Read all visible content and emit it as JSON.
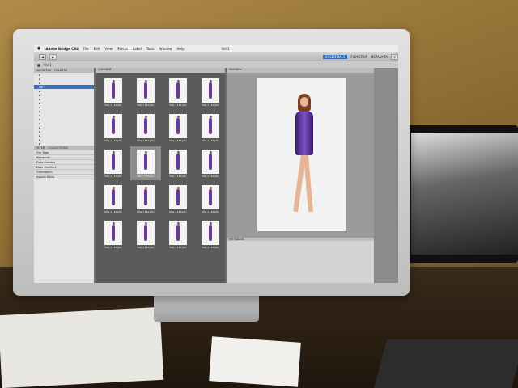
{
  "app": {
    "name": "Adobe Bridge CS4",
    "menu": [
      "File",
      "Edit",
      "View",
      "Stacks",
      "Label",
      "Tools",
      "Window",
      "Help"
    ],
    "window_title": "Vol 1"
  },
  "toolbar": {
    "workspace": "ESSENTIALS",
    "filmstrip": "FILMSTRIP",
    "metadata": "METADATA"
  },
  "left_panel": {
    "tabs": [
      "FAVORITES",
      "FOLDERS"
    ],
    "filter_tabs": [
      "FILTER",
      "COLLECTIONS"
    ],
    "filters": [
      "File Type",
      "Keywords",
      "Date Created",
      "Date Modified",
      "Orientation",
      "Aspect Ratio"
    ]
  },
  "content": {
    "header": "CONTENT"
  },
  "thumbnails": [
    {
      "caption": "IMG_1149.JPG",
      "selected": false
    },
    {
      "caption": "IMG_1150.JPG",
      "selected": false
    },
    {
      "caption": "IMG_1151.JPG",
      "selected": false
    },
    {
      "caption": "IMG_1152.JPG",
      "selected": false
    },
    {
      "caption": "IMG_1153.JPG",
      "selected": false
    },
    {
      "caption": "IMG_1154.JPG",
      "selected": false
    },
    {
      "caption": "IMG_1155.JPG",
      "selected": false
    },
    {
      "caption": "IMG_1156.JPG",
      "selected": false
    },
    {
      "caption": "IMG_1157.JPG",
      "selected": false
    },
    {
      "caption": "IMG_1158.JPG",
      "selected": true
    },
    {
      "caption": "IMG_1159.JPG",
      "selected": false
    },
    {
      "caption": "IMG_1160.JPG",
      "selected": false
    },
    {
      "caption": "IMG_1161.JPG",
      "selected": false
    },
    {
      "caption": "IMG_1162.JPG",
      "selected": false
    },
    {
      "caption": "IMG_1163.JPG",
      "selected": false
    },
    {
      "caption": "IMG_1164.JPG",
      "selected": false
    },
    {
      "caption": "IMG_1165.JPG",
      "selected": false
    },
    {
      "caption": "IMG_1166.JPG",
      "selected": false
    },
    {
      "caption": "IMG_1167.JPG",
      "selected": false
    },
    {
      "caption": "IMG_1168.JPG",
      "selected": false
    }
  ],
  "preview": {
    "header": "PREVIEW"
  },
  "metadata_panel": {
    "header": "METADATA"
  },
  "colors": {
    "dress": "#6a3a9a",
    "selection": "#3b6fc2",
    "workspace_tab": "#2c6fb3"
  }
}
